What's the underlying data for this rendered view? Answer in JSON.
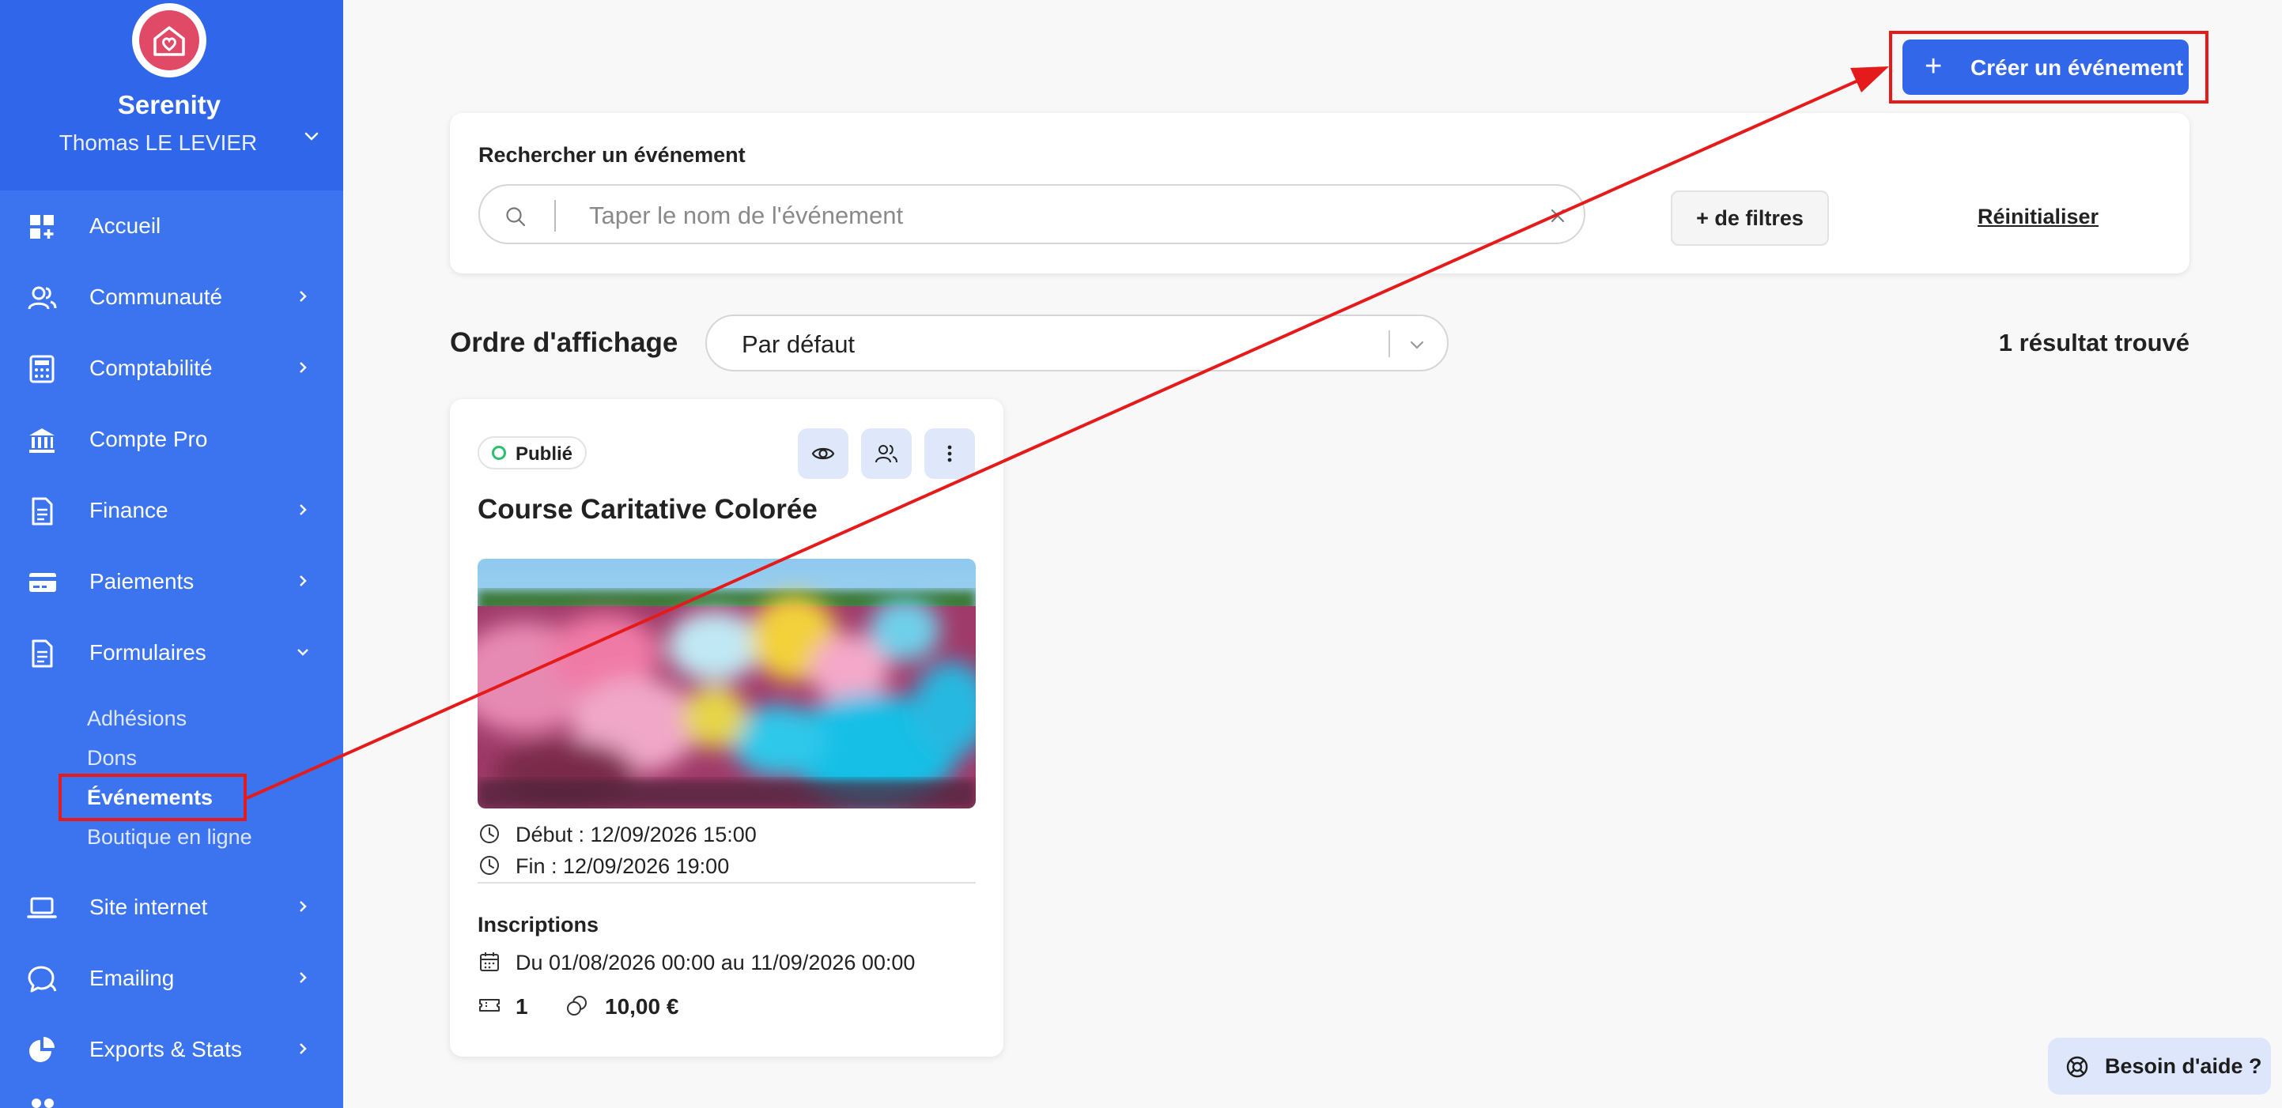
{
  "sidebar": {
    "org_name": "Serenity",
    "user_name": "Thomas LE LEVIER",
    "items": [
      {
        "label": "Accueil"
      },
      {
        "label": "Communauté"
      },
      {
        "label": "Comptabilité"
      },
      {
        "label": "Compte Pro"
      },
      {
        "label": "Finance"
      },
      {
        "label": "Paiements"
      },
      {
        "label": "Formulaires"
      },
      {
        "label": "Site internet"
      },
      {
        "label": "Emailing"
      },
      {
        "label": "Exports & Stats"
      }
    ],
    "sub_items": [
      {
        "label": "Adhésions"
      },
      {
        "label": "Dons"
      },
      {
        "label": "Événements"
      },
      {
        "label": "Boutique en ligne"
      }
    ],
    "active_sub_item": "Événements"
  },
  "header": {
    "create_label": "Créer un événement"
  },
  "search": {
    "title": "Rechercher un événement",
    "placeholder": "Taper le nom de l'événement",
    "value": "",
    "filters_label": "+ de filtres",
    "reset_label": "Réinitialiser"
  },
  "order": {
    "label": "Ordre d'affichage",
    "selected": "Par défaut",
    "result_count": "1 résultat trouvé"
  },
  "event_card": {
    "status": "Publié",
    "title": "Course Caritative Colorée",
    "start": "Début : 12/09/2026 15:00",
    "end": "Fin : 12/09/2026 19:00",
    "registrations_title": "Inscriptions",
    "registration_period": "Du 01/08/2026 00:00 au 11/09/2026 00:00",
    "tickets_count": "1",
    "price": "10,00 €"
  },
  "help": {
    "label": "Besoin d'aide ?"
  },
  "colors": {
    "sidebar": "#3b74ee",
    "sidebar_top": "#2f66ea",
    "primary": "#3367e9",
    "annotation": "#e51b1b",
    "status_published": "#2bbf72",
    "logo": "#e14a67"
  }
}
